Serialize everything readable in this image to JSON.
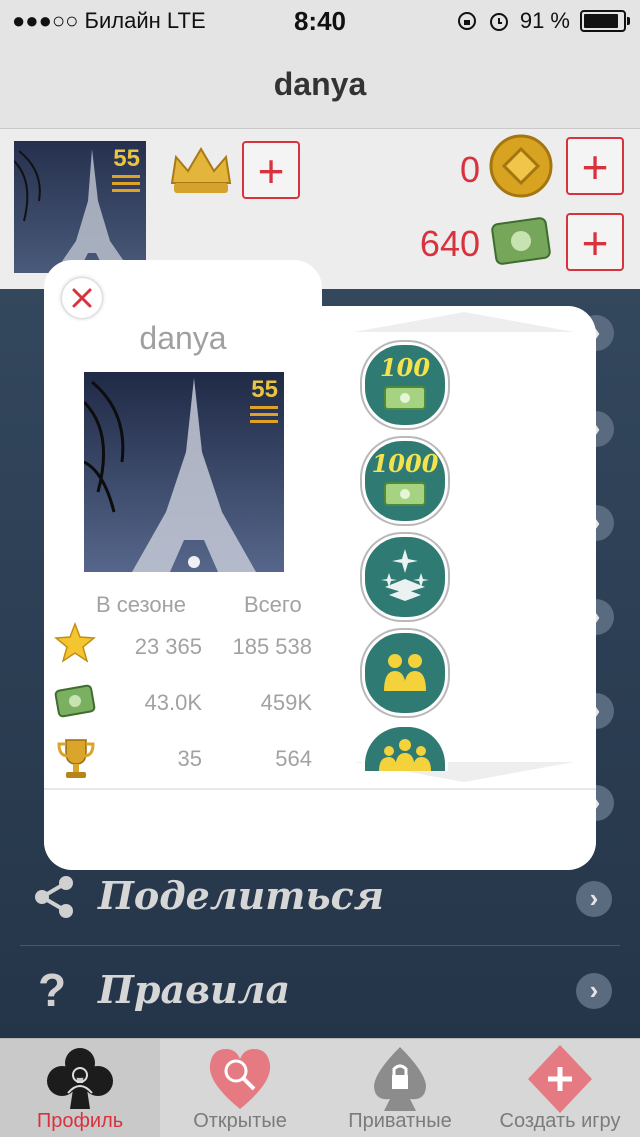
{
  "status_bar": {
    "carrier": "●●●○○ Билайн  LTE",
    "time": "8:40",
    "battery": "91 %"
  },
  "nav": {
    "title": "danya"
  },
  "header": {
    "level": "55",
    "coins": "0",
    "money": "640"
  },
  "menu": {
    "items": [
      {
        "label": "Поделиться",
        "icon": "share-icon"
      },
      {
        "label": "Правила",
        "icon": "question-icon"
      }
    ]
  },
  "popup": {
    "name": "danya",
    "level": "55",
    "col_season": "В сезоне",
    "col_total": "Всего",
    "stats": [
      {
        "icon": "star-icon",
        "season": "23 365",
        "total": "185 538"
      },
      {
        "icon": "money-icon",
        "season": "43.0K",
        "total": "459K"
      },
      {
        "icon": "trophy-icon",
        "season": "35",
        "total": "564"
      }
    ],
    "achievements": [
      {
        "label": "100",
        "icon": "money-icon"
      },
      {
        "label": "1000",
        "icon": "money-icon"
      },
      {
        "label": "",
        "icon": "stars-chevron-icon"
      },
      {
        "label": "",
        "icon": "two-people-icon"
      },
      {
        "label": "",
        "icon": "group-icon"
      }
    ]
  },
  "tabs": [
    {
      "label": "Профиль",
      "active": true,
      "icon": "club-person-icon"
    },
    {
      "label": "Открытые",
      "active": false,
      "icon": "heart-search-icon"
    },
    {
      "label": "Приватные",
      "active": false,
      "icon": "spade-lock-icon"
    },
    {
      "label": "Создать игру",
      "active": false,
      "icon": "diamond-plus-icon"
    }
  ],
  "colors": {
    "accent": "#d9323f",
    "panel": "#2c3e54",
    "gold": "#e8c441"
  }
}
